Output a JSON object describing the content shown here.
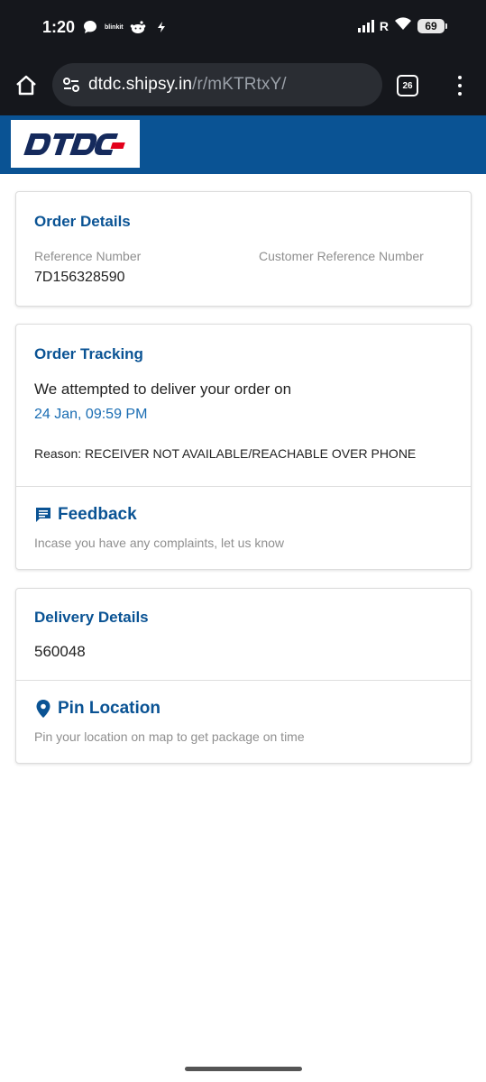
{
  "status_bar": {
    "time": "1:20",
    "apps": [
      "chat-app-icon",
      "blinkit",
      "reddit-icon",
      "flash-icon"
    ],
    "blinkit_label": "blinkit",
    "signal_suffix": "R",
    "battery": "69"
  },
  "browser": {
    "url_domain": "dtdc.shipsy.in",
    "url_path": "/r/mKTRtxY/",
    "tab_count": "26"
  },
  "brand": {
    "logo_text": "DTDC",
    "header_color": "#0a5394",
    "accent_color": "#e3001b"
  },
  "order_details": {
    "title": "Order Details",
    "ref_label": "Reference Number",
    "ref_value": "7D156328590",
    "cust_ref_label": "Customer Reference Number",
    "cust_ref_value": ""
  },
  "order_tracking": {
    "title": "Order Tracking",
    "message": "We attempted to deliver your order on",
    "date": "24 Jan, 09:59 PM",
    "reason": "Reason: RECEIVER NOT AVAILABLE/REACHABLE OVER PHONE",
    "feedback_title": "Feedback",
    "feedback_hint": "Incase you have any complaints, let us know"
  },
  "delivery_details": {
    "title": "Delivery Details",
    "pincode": "560048",
    "pin_title": "Pin Location",
    "pin_hint": "Pin your location on map to get package on time"
  }
}
